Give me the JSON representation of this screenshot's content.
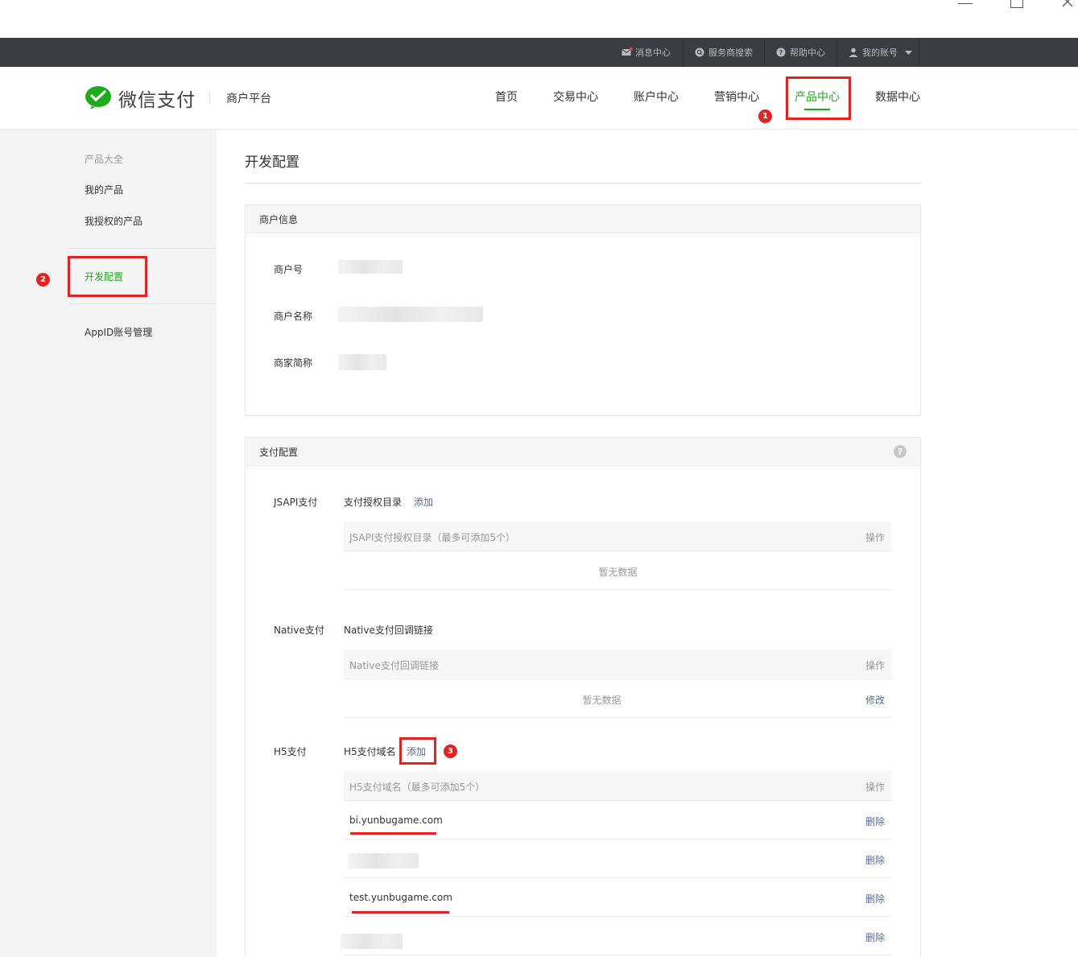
{
  "topbar": {
    "items": [
      {
        "label": "消息中心",
        "icon": "mail-icon"
      },
      {
        "label": "服务商搜索",
        "icon": "search-circle-icon"
      },
      {
        "label": "帮助中心",
        "icon": "help-icon"
      },
      {
        "label": "我的账号",
        "icon": "user-icon"
      }
    ]
  },
  "header": {
    "brand": "微信支付",
    "platform": "商户平台",
    "nav": [
      "首页",
      "交易中心",
      "账户中心",
      "营销中心",
      "产品中心",
      "数据中心"
    ],
    "active_nav_index": 4,
    "accent_color": "#1aad19"
  },
  "annotations": {
    "one": "1",
    "two": "2",
    "three": "3",
    "color": "#e52222"
  },
  "sidebar": {
    "group_title": "产品大全",
    "items": [
      "我的产品",
      "我授权的产品",
      "开发配置",
      "AppID账号管理"
    ]
  },
  "main": {
    "title": "开发配置",
    "merchant_panel": {
      "title": "商户信息",
      "fields": [
        "商户号",
        "商户名称",
        "商家简称"
      ]
    },
    "pay_panel": {
      "title": "支付配置",
      "help": "?",
      "jsapi": {
        "label": "JSAPI支付",
        "sub_label": "支付授权目录",
        "add": "添加",
        "col_left": "JSAPI支付授权目录（最多可添加5个）",
        "col_right": "操作",
        "empty": "暂无数据"
      },
      "native": {
        "label": "Native支付",
        "sub_label": "Native支付回调链接",
        "col_left": "Native支付回调链接",
        "col_right": "操作",
        "empty": "暂无数据",
        "edit": "修改"
      },
      "h5": {
        "label": "H5支付",
        "sub_label": "H5支付域名",
        "add": "添加",
        "col_left": "H5支付域名（最多可添加5个）",
        "col_right": "操作",
        "rows": [
          {
            "domain": "bi.yunbugame.com",
            "action": "删除"
          },
          {
            "domain": "",
            "action": "删除"
          },
          {
            "domain": "test.yunbugame.com",
            "action": "删除"
          },
          {
            "domain": "",
            "action": "删除"
          }
        ]
      }
    }
  }
}
